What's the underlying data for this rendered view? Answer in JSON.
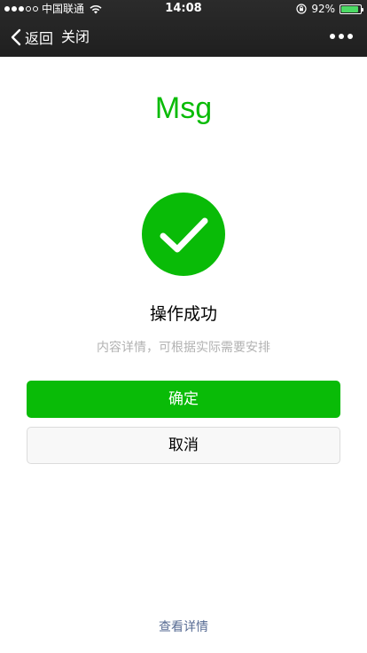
{
  "status_bar": {
    "carrier": "中国联通",
    "time": "14:08",
    "battery_percent": "92%",
    "battery_level": 0.92,
    "signal_bars_filled": 3,
    "signal_bars_total": 5,
    "icons": [
      "signal-dots-icon",
      "wifi-icon",
      "orientation-lock-icon",
      "battery-icon"
    ]
  },
  "nav": {
    "back_label": "返回",
    "close_label": "关闭",
    "icons": [
      "chevron-left-icon",
      "more-dots-icon"
    ]
  },
  "content": {
    "title": "Msg",
    "icon": "success-check-icon",
    "result_title": "操作成功",
    "result_desc": "内容详情，可根据实际需要安排",
    "confirm_label": "确定",
    "cancel_label": "取消",
    "footer_link": "查看详情"
  },
  "colors": {
    "primary": "#09bb07",
    "topbar": "#232323",
    "desc_text": "#b2b2b2",
    "link": "#586c94",
    "battery": "#4cd964"
  }
}
